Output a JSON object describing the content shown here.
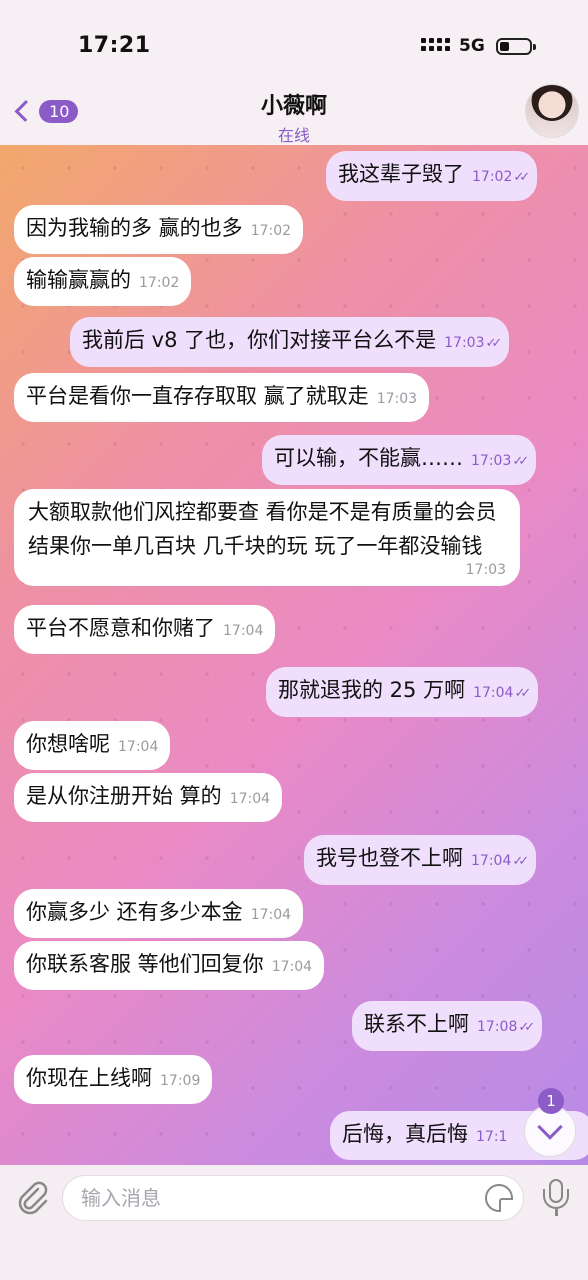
{
  "status_bar": {
    "time": "17:21",
    "network": "5G"
  },
  "header": {
    "back_count": "10",
    "name": "小薇啊",
    "status": "在线"
  },
  "messages": [
    {
      "dir": "out",
      "text": "我这辈子毁了",
      "time": "17:02"
    },
    {
      "dir": "in",
      "text": "因为我输的多 赢的也多",
      "time": "17:02"
    },
    {
      "dir": "in",
      "text": "输输赢赢的",
      "time": "17:02"
    },
    {
      "dir": "out",
      "text": "我前后 v8 了也，你们对接平台么不是",
      "time": "17:03"
    },
    {
      "dir": "in",
      "text": "平台是看你一直存存取取 赢了就取走",
      "time": "17:03"
    },
    {
      "dir": "out",
      "text": "可以输，不能赢……",
      "time": "17:03"
    },
    {
      "dir": "in",
      "text": "大额取款他们风控都要查 看你是不是有质量的会员 结果你一单几百块 几千块的玩 玩了一年都没输钱",
      "time": "17:03"
    },
    {
      "dir": "in",
      "text": "平台不愿意和你赌了",
      "time": "17:04"
    },
    {
      "dir": "out",
      "text": "那就退我的 25 万啊",
      "time": "17:04"
    },
    {
      "dir": "in",
      "text": "你想啥呢",
      "time": "17:04"
    },
    {
      "dir": "in",
      "text": "是从你注册开始 算的",
      "time": "17:04"
    },
    {
      "dir": "out",
      "text": "我号也登不上啊",
      "time": "17:04"
    },
    {
      "dir": "in",
      "text": "你赢多少 还有多少本金",
      "time": "17:04"
    },
    {
      "dir": "in",
      "text": "你联系客服 等他们回复你",
      "time": "17:04"
    },
    {
      "dir": "out",
      "text": "联系不上啊",
      "time": "17:08"
    },
    {
      "dir": "in",
      "text": "你现在上线啊",
      "time": "17:09"
    },
    {
      "dir": "out",
      "text": "后悔，真后悔",
      "time": "17:1"
    }
  ],
  "scroll": {
    "unread": "1"
  },
  "composer": {
    "placeholder": "输入消息"
  },
  "icons": [
    "back-chevron-icon",
    "attach-icon",
    "sticker-icon",
    "mic-icon",
    "chevron-down-icon",
    "read-check-icon"
  ],
  "colors": {
    "accent": "#8b5cc7",
    "incoming": "#ffffff",
    "outgoing": "#f0defd"
  }
}
